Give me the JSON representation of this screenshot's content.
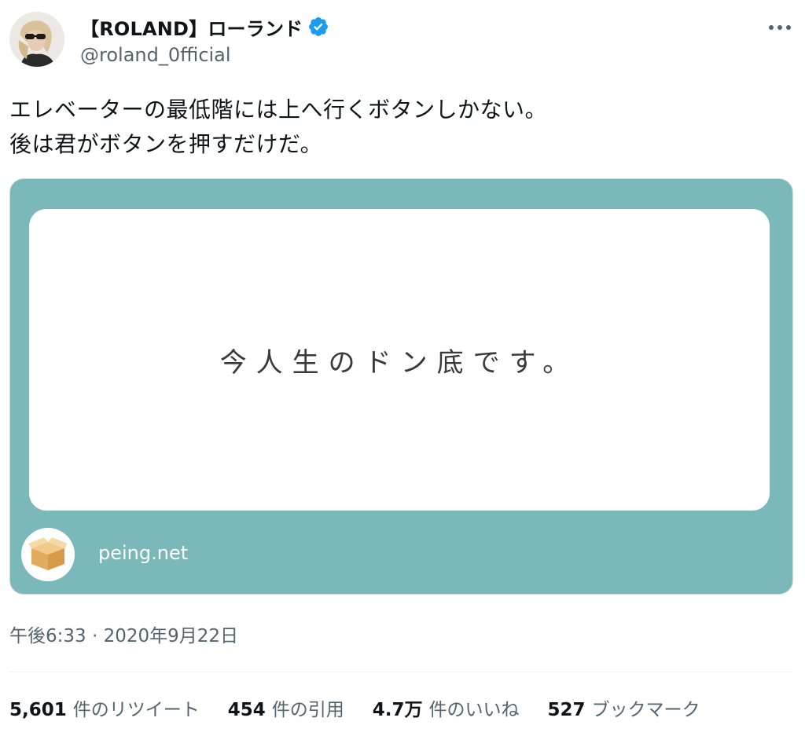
{
  "author": {
    "display_name": "【ROLAND】ローランド",
    "handle": "@roland_0fficial",
    "verified_badge_icon": "verified-badge-icon",
    "avatar_icon": "profile-photo"
  },
  "more_icon": "more-options-icon",
  "tweet": {
    "lines": [
      "エレベーターの最低階には上へ行くボタンしかない。",
      "後は君がボタンを押すだけだ。"
    ]
  },
  "card": {
    "question": "今人生のドン底です。",
    "site": "peing.net",
    "logo_icon": "cardboard-box-icon",
    "background_color": "#7ab8ba"
  },
  "timestamp": "午後6:33 · 2020年9月22日",
  "stats": [
    {
      "value": "5,601",
      "label": "件のリツイート"
    },
    {
      "value": "454",
      "label": "件の引用"
    },
    {
      "value": "4.7万",
      "label": "件のいいね"
    },
    {
      "value": "527",
      "label": "ブックマーク"
    }
  ],
  "colors": {
    "text_primary": "#0f1419",
    "text_secondary": "#536471",
    "verified_blue": "#1d9bf0"
  }
}
